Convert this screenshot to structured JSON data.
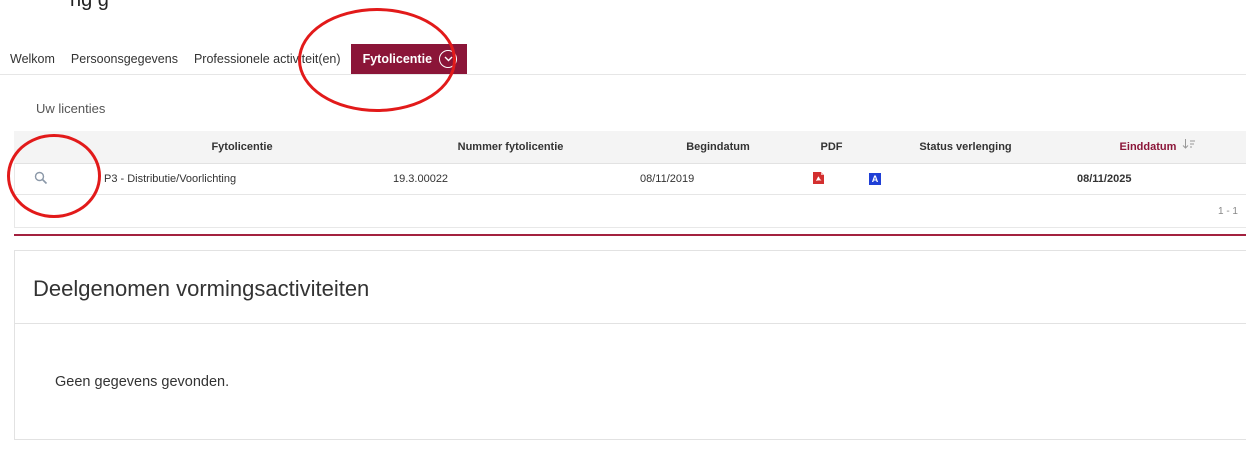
{
  "top_text": "ng  g",
  "nav": {
    "items": [
      "Welkom",
      "Persoonsgegevens",
      "Professionele activiteit(en)"
    ],
    "active": "Fytolicentie"
  },
  "section_label": "Uw licenties",
  "table": {
    "headers": {
      "fytolicentie": "Fytolicentie",
      "nummer": "Nummer fytolicentie",
      "begindatum": "Begindatum",
      "pdf": "PDF",
      "status": "Status verlenging",
      "einddatum": "Einddatum"
    },
    "sorted_column": "einddatum",
    "rows": [
      {
        "fytolicentie": "P3 - Distributie/Voorlichting",
        "nummer": "19.3.00022",
        "begindatum": "08/11/2019",
        "pdf_icon": "pdf-icon",
        "status_badge": "A",
        "einddatum": "08/11/2025"
      }
    ],
    "pager": "1 - 1"
  },
  "panel": {
    "title": "Deelgenomen vormingsactiviteiten",
    "empty_text": "Geen gegevens gevonden."
  },
  "colors": {
    "accent": "#8b1538",
    "divider": "#a3213f",
    "annotation": "#e21a1a",
    "status_badge": "#1f3fd6",
    "pdf_red": "#d32f2f"
  }
}
